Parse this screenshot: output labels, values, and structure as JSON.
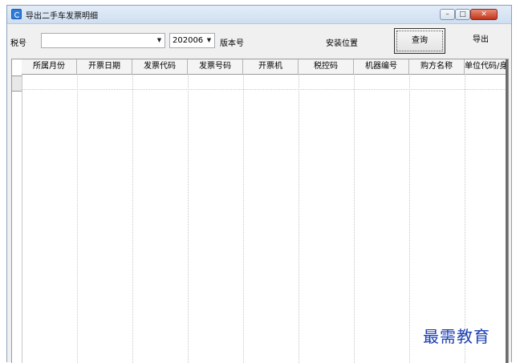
{
  "window": {
    "title": "导出二手车发票明细",
    "controls": {
      "minimize": "–",
      "maximize": "□",
      "close": "✕"
    }
  },
  "toolbar": {
    "tax_label": "税号",
    "tax_value": "",
    "period_value": "202006",
    "version_label": "版本号",
    "install_label": "安装位置",
    "query_label": "查询",
    "export_label": "导出"
  },
  "table": {
    "columns": [
      "所属月份",
      "开票日期",
      "发票代码",
      "发票号码",
      "开票机",
      "税控码",
      "机器编号",
      "购方名称",
      "单位代码/身"
    ],
    "rows": []
  },
  "watermark": "最需教育"
}
